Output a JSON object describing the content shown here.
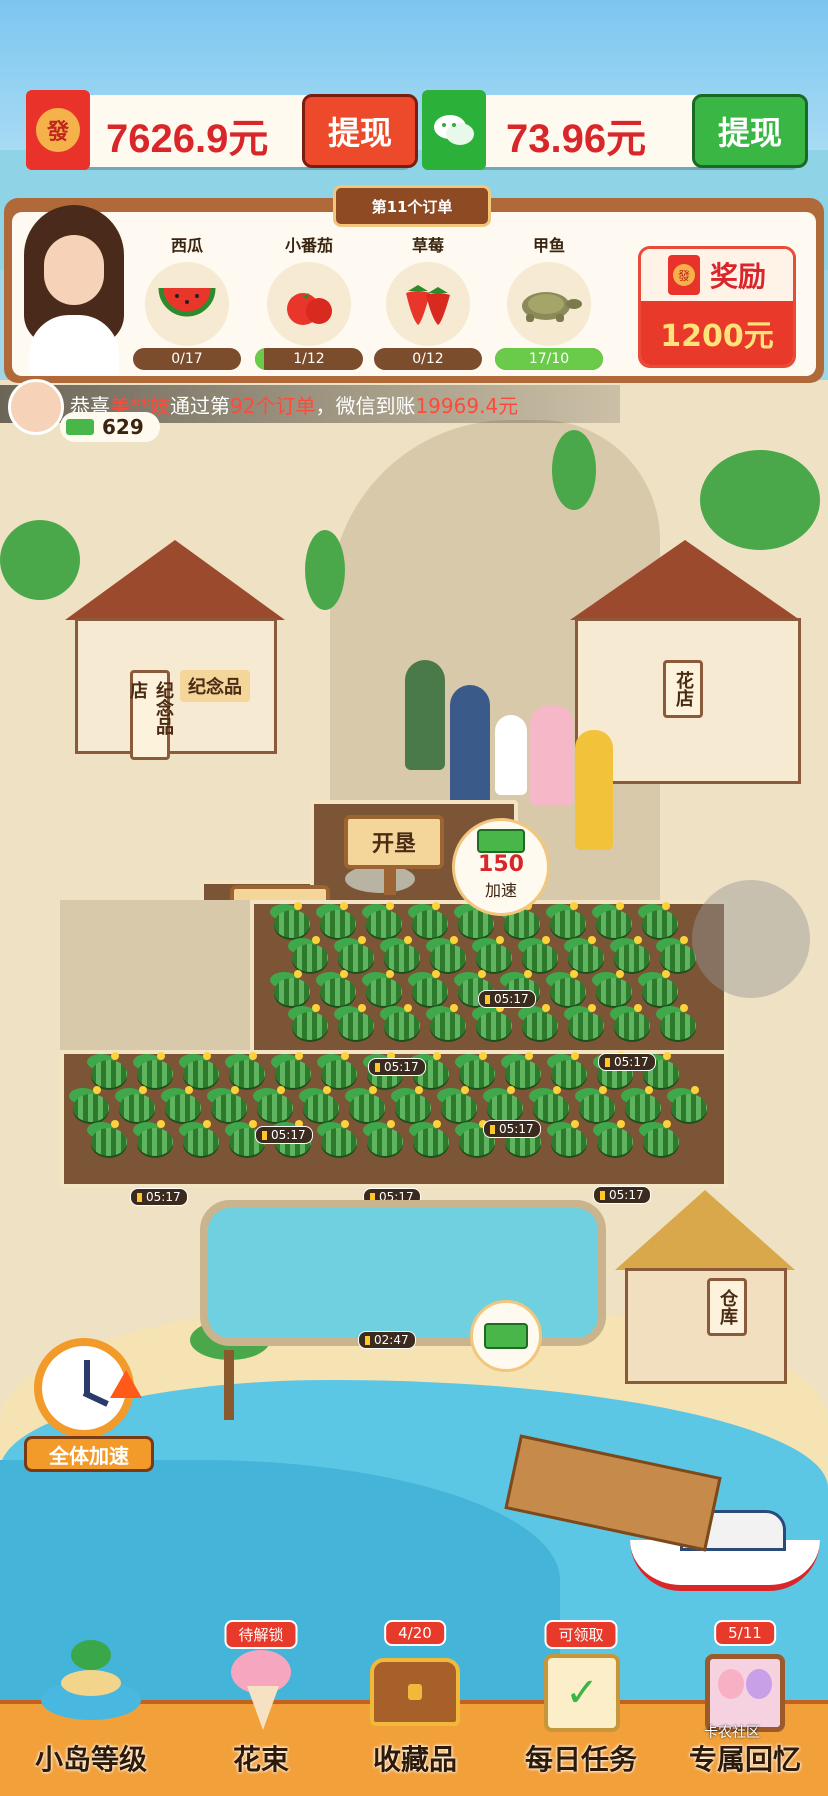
{
  "header": {
    "red_balance": "7626.9元",
    "red_icon_text": "發",
    "red_withdraw": "提现",
    "wechat_balance": "73.96元",
    "wechat_withdraw": "提现"
  },
  "order": {
    "title": "第11个订单",
    "items": [
      {
        "name": "西瓜",
        "icon": "watermelon-icon",
        "progress": "0/17",
        "fill": 0
      },
      {
        "name": "小番茄",
        "icon": "tomato-icon",
        "progress": "1/12",
        "fill": 0.08
      },
      {
        "name": "草莓",
        "icon": "strawberry-icon",
        "progress": "0/12",
        "fill": 0
      },
      {
        "name": "甲鱼",
        "icon": "turtle-icon",
        "progress": "17/10",
        "fill": 1
      }
    ],
    "reward_label": "奖励",
    "reward_amount": "1200元"
  },
  "ticker": {
    "prefix": "恭喜",
    "user": "美**妓",
    "mid": "通过第",
    "count": "92个订单",
    "mid2": "，微信到账",
    "amount": "19969.4元"
  },
  "player": {
    "cash_count": "629"
  },
  "farm": {
    "reclaim_label": "开垦",
    "timers": [
      "05:17",
      "05:17",
      "05:17",
      "05:17",
      "05:17",
      "05:17",
      "05:17",
      "05:17",
      "05:17"
    ],
    "pond_timer": "02:47",
    "speedup_amount": "150",
    "speedup_label": "加速"
  },
  "buildings": {
    "souvenir_shop": "纪念品店",
    "flower_shop": "花店",
    "warehouse": "仓库",
    "souvenir_sign": "纪念品"
  },
  "global_speedup": "全体加速",
  "nav": [
    {
      "label": "小岛等级",
      "badge": "",
      "icon": "island-icon"
    },
    {
      "label": "花束",
      "badge": "待解锁",
      "icon": "bouquet-icon"
    },
    {
      "label": "收藏品",
      "badge": "4/20",
      "icon": "treasure-chest-icon"
    },
    {
      "label": "每日任务",
      "badge": "可领取",
      "icon": "task-scroll-icon"
    },
    {
      "label": "专属回忆",
      "badge": "5/11",
      "icon": "photo-album-icon"
    }
  ],
  "watermark": "卡农社区"
}
